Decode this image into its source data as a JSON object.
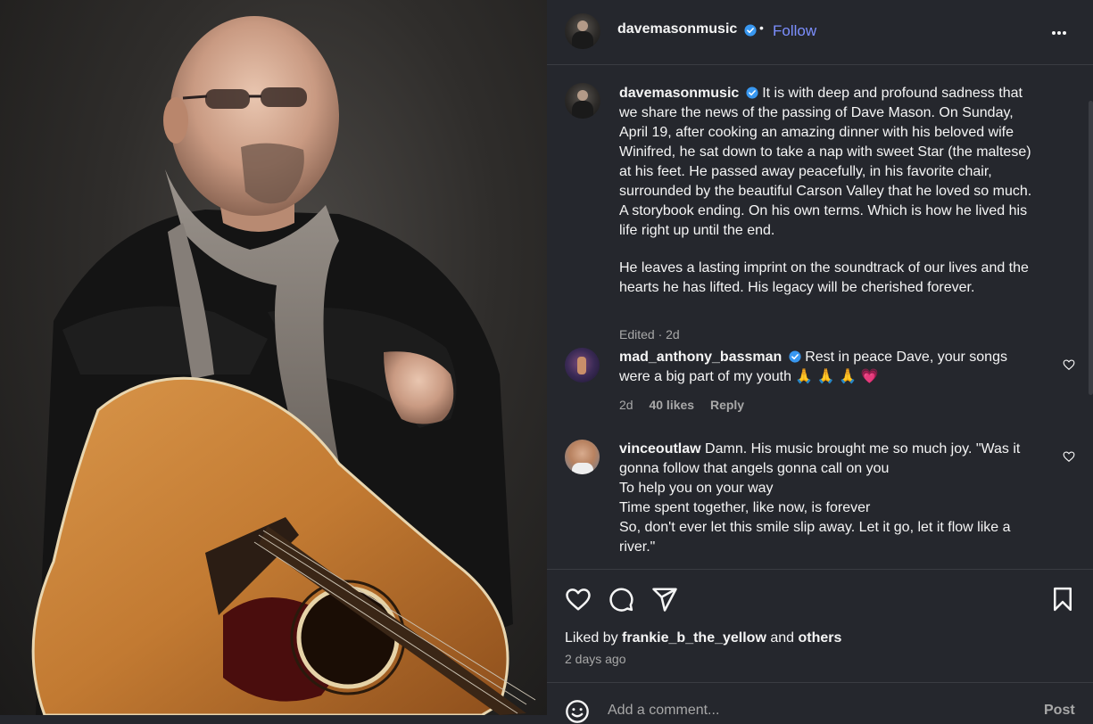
{
  "post": {
    "username": "davemasonmusic",
    "dot": "•",
    "follow_label": "Follow",
    "caption_lines": [
      "It is with deep and profound sadness that",
      "we share the news of the passing of Dave Mason. On Sunday,",
      "April 19, after cooking an amazing dinner with his beloved wife",
      "Winifred, he sat down to take a nap with sweet Star (the maltese)",
      "at his feet. He passed away peacefully, in his favorite chair,",
      "surrounded by the beautiful Carson Valley that he loved so much.",
      "A storybook ending. On his own terms. Which is how he lived his",
      "life right up until the end."
    ],
    "caption_para2_lines": [
      "He leaves a lasting imprint on the soundtrack of our lives and the",
      "hearts he has lifted. His legacy will be cherished forever."
    ],
    "caption_meta": "Edited · 2d",
    "liked_prefix": "Liked by",
    "liked_user": "frankie_b_the_yellow",
    "liked_and": "and",
    "liked_others": "others",
    "time_ago": "2 days ago",
    "add_comment_placeholder": "Add a comment...",
    "post_label": "Post"
  },
  "comments": [
    {
      "username": "mad_anthony_bassman",
      "verified": true,
      "lines": [
        "Rest in peace Dave, your songs",
        "were a big part of my youth 🙏 🙏 🙏 💗"
      ],
      "age": "2d",
      "likes": "40 likes",
      "reply": "Reply"
    },
    {
      "username": "vinceoutlaw",
      "verified": false,
      "lines": [
        "Damn. His music brought me so much joy. \"Was it",
        "gonna follow that angels gonna call on you",
        "To help you on your way",
        "Time spent together, like now, is forever",
        "So, don't ever let this smile slip away. Let it go, let it flow like a",
        "river.\""
      ]
    }
  ],
  "icons": {
    "verified": "verified-badge-icon",
    "more": "more-options-icon",
    "like": "heart-icon",
    "comment": "comment-icon",
    "share": "share-icon",
    "save": "bookmark-icon",
    "emoji": "emoji-icon"
  },
  "colors": {
    "background": "#25272d",
    "link": "#7c8fff",
    "verified": "#3897f0",
    "muted": "#a8a8a8"
  }
}
